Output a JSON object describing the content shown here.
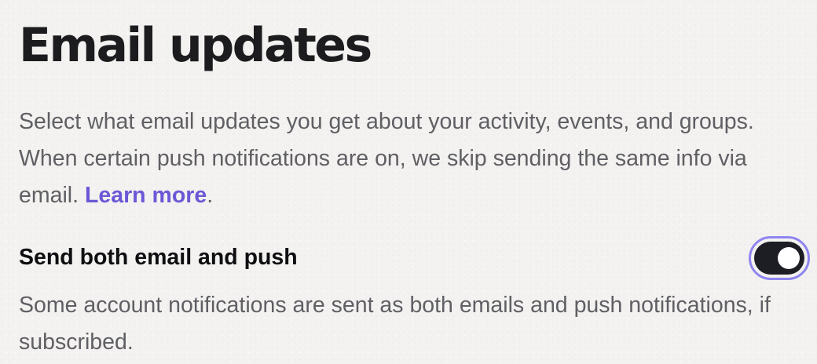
{
  "section": {
    "title": "Email updates",
    "description_text": "Select what email updates you get about your activity, events, and groups. When certain push notifications are on, we skip sending the same info via email. ",
    "learn_more_label": "Learn more",
    "description_suffix": "."
  },
  "setting": {
    "label": "Send both email and push",
    "help_text": "Some account notifications are sent as both emails and push notifications, if subscribed.",
    "toggle_state": "on"
  },
  "colors": {
    "link": "#6b58d6",
    "toggle_track": "#1d1d24",
    "focus_ring": "#8f85f0",
    "background": "#f3f2f0"
  }
}
